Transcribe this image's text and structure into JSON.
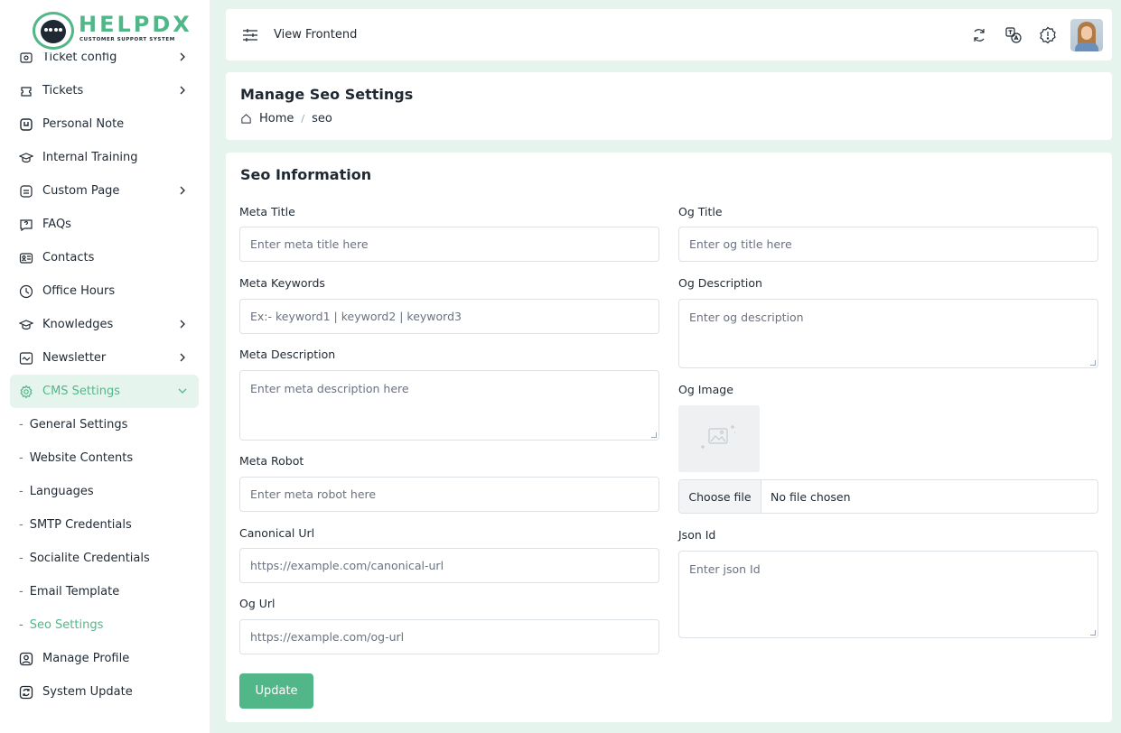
{
  "brand": {
    "name": "HELPDX",
    "tagline": "CUSTOMER SUPPORT SYSTEM"
  },
  "sidebar": {
    "items": [
      {
        "label": "Ticket config",
        "icon": "ticket-config-icon",
        "chevron": true
      },
      {
        "label": "Tickets",
        "icon": "tickets-icon",
        "chevron": true
      },
      {
        "label": "Personal Note",
        "icon": "note-icon",
        "chevron": false
      },
      {
        "label": "Internal Training",
        "icon": "training-icon",
        "chevron": false
      },
      {
        "label": "Custom Page",
        "icon": "page-icon",
        "chevron": true
      },
      {
        "label": "FAQs",
        "icon": "faq-icon",
        "chevron": false
      },
      {
        "label": "Contacts",
        "icon": "contacts-icon",
        "chevron": false
      },
      {
        "label": "Office Hours",
        "icon": "clock-icon",
        "chevron": false
      },
      {
        "label": "Knowledges",
        "icon": "knowledge-icon",
        "chevron": true
      },
      {
        "label": "Newsletter",
        "icon": "newsletter-icon",
        "chevron": true
      },
      {
        "label": "CMS Settings",
        "icon": "gear-icon",
        "chevron": true,
        "active": true
      }
    ],
    "cms_sub": [
      {
        "label": "General Settings"
      },
      {
        "label": "Website Contents"
      },
      {
        "label": "Languages"
      },
      {
        "label": "SMTP Credentials"
      },
      {
        "label": "Socialite Credentials"
      },
      {
        "label": "Email Template"
      },
      {
        "label": "Seo Settings",
        "active": true
      }
    ],
    "bottom": [
      {
        "label": "Manage Profile",
        "icon": "profile-icon"
      },
      {
        "label": "System Update",
        "icon": "update-icon"
      }
    ]
  },
  "topbar": {
    "view_frontend": "View Frontend"
  },
  "header": {
    "title": "Manage Seo Settings",
    "breadcrumb_home": "Home",
    "breadcrumb_current": "seo",
    "breadcrumb_sep": "/"
  },
  "form": {
    "title": "Seo Information",
    "meta_title": {
      "label": "Meta Title",
      "placeholder": "Enter meta title here"
    },
    "meta_keywords": {
      "label": "Meta Keywords",
      "placeholder": "Ex:- keyword1 | keyword2 | keyword3"
    },
    "meta_description": {
      "label": "Meta Description",
      "placeholder": "Enter meta description here"
    },
    "meta_robot": {
      "label": "Meta Robot",
      "placeholder": "Enter meta robot here"
    },
    "canonical_url": {
      "label": "Canonical Url",
      "placeholder": "https://example.com/canonical-url"
    },
    "og_url": {
      "label": "Og Url",
      "placeholder": "https://example.com/og-url"
    },
    "og_title": {
      "label": "Og Title",
      "placeholder": "Enter og title here"
    },
    "og_description": {
      "label": "Og Description",
      "placeholder": "Enter og description"
    },
    "og_image": {
      "label": "Og Image",
      "choose": "Choose file",
      "status": "No file chosen"
    },
    "json_id": {
      "label": "Json Id",
      "placeholder": "Enter json Id"
    },
    "submit": "Update"
  },
  "colors": {
    "accent": "#52b788",
    "bg": "#e6f4ee"
  }
}
